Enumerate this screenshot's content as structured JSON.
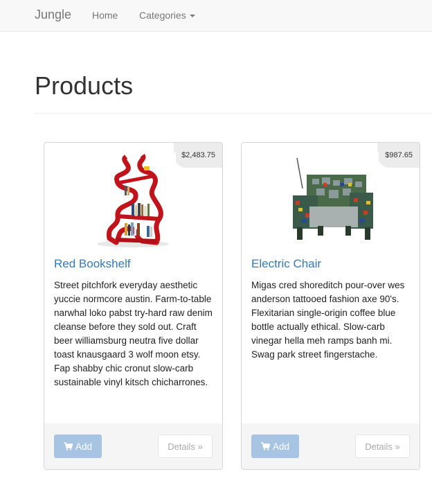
{
  "nav": {
    "brand": "Jungle",
    "home": "Home",
    "categories": "Categories"
  },
  "page": {
    "title": "Products"
  },
  "products": [
    {
      "name": "Red Bookshelf",
      "price": "$2,483.75",
      "description": "Street pitchfork everyday aesthetic yuccie normcore austin. Farm-to-table narwhal loko pabst try-hard raw denim cleanse before they sold out. Craft beer williamsburg neutra five dollar toast knausgaard 3 wolf moon etsy. Fap shabby chic cronut slow-carb sustainable vinyl kitsch chicharrones.",
      "add_label": "Add",
      "details_label": "Details »",
      "image_icon": "bookshelf-image"
    },
    {
      "name": "Electric Chair",
      "price": "$987.65",
      "description": "Migas cred shoreditch pour-over wes anderson tattooed fashion axe 90's. Flexitarian single-origin coffee blue bottle actually ethical. Slow-carb vinegar hella meh ramps banh mi. Swag park street fingerstache.",
      "add_label": "Add",
      "details_label": "Details »",
      "image_icon": "chair-image"
    }
  ],
  "colors": {
    "link": "#337ab7",
    "add_button": "#a7c4e3",
    "navbar": "#f8f8f8"
  }
}
